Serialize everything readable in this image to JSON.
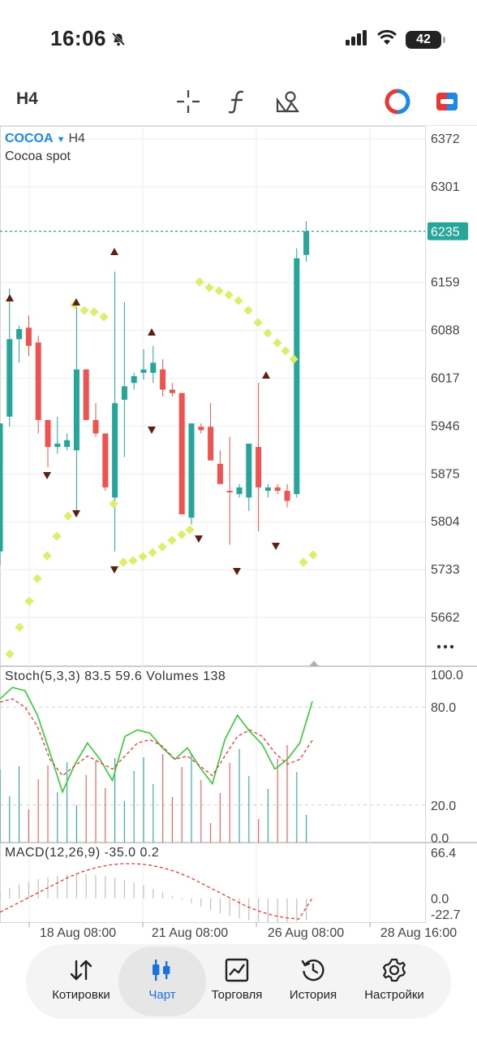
{
  "status_bar": {
    "time": "16:06",
    "battery": "42"
  },
  "toolbar": {
    "timeframe": "H4",
    "icons": [
      "crosshair-icon",
      "function-icon",
      "objects-icon",
      "oneclick-trading-icon",
      "chart-window-icon"
    ]
  },
  "chart": {
    "symbol": "COCOA",
    "timeframe": "H4",
    "description": "Cocoa spot",
    "current_price": "6235",
    "price_ticks": [
      "6372",
      "6301",
      "6159",
      "6088",
      "6017",
      "5946",
      "5875",
      "5804",
      "5733",
      "5662"
    ],
    "time_ticks": [
      "18 Aug 08:00",
      "21 Aug 08:00",
      "26 Aug 08:00",
      "28 Aug 16:00"
    ],
    "colors": {
      "bull": "#26a69a",
      "bear": "#ef5350",
      "psar": "#dbef6b",
      "fractal": "#5d1f10",
      "price_line": "#26a69a"
    }
  },
  "stoch": {
    "label": "Stoch(5,3,3) 83.5 59.6 Volumes 138",
    "ticks": [
      "100.0",
      "80.0",
      "20.0",
      "0.0"
    ]
  },
  "macd": {
    "label": "MACD(12,26,9) -35.0 0.2",
    "ticks": [
      "66.4",
      "0.0",
      "-22.7"
    ]
  },
  "chart_data": {
    "type": "candlestick",
    "title": "COCOA H4",
    "ylim": [
      5620,
      6400
    ],
    "candles": [
      {
        "o": 5760,
        "h": 5950,
        "l": 5740,
        "c": 5950,
        "dir": "up"
      },
      {
        "o": 5960,
        "h": 6150,
        "l": 5945,
        "c": 6075,
        "dir": "up"
      },
      {
        "o": 6075,
        "h": 6095,
        "l": 6040,
        "c": 6090,
        "dir": "up"
      },
      {
        "o": 6092,
        "h": 6110,
        "l": 6050,
        "c": 6065,
        "dir": "down"
      },
      {
        "o": 6070,
        "h": 6080,
        "l": 5935,
        "c": 5955,
        "dir": "down"
      },
      {
        "o": 5955,
        "h": 5955,
        "l": 5885,
        "c": 5915,
        "dir": "down"
      },
      {
        "o": 5915,
        "h": 5960,
        "l": 5905,
        "c": 5920,
        "dir": "up"
      },
      {
        "o": 5915,
        "h": 5935,
        "l": 5910,
        "c": 5925,
        "dir": "up"
      },
      {
        "o": 5910,
        "h": 6130,
        "l": 5820,
        "c": 6030,
        "dir": "up"
      },
      {
        "o": 6030,
        "h": 6030,
        "l": 5955,
        "c": 5955,
        "dir": "down"
      },
      {
        "o": 5955,
        "h": 5980,
        "l": 5930,
        "c": 5935,
        "dir": "down"
      },
      {
        "o": 5935,
        "h": 5935,
        "l": 5850,
        "c": 5855,
        "dir": "down"
      },
      {
        "o": 5840,
        "h": 6175,
        "l": 5760,
        "c": 5980,
        "dir": "up"
      },
      {
        "o": 5985,
        "h": 6130,
        "l": 5900,
        "c": 6005,
        "dir": "up"
      },
      {
        "o": 6010,
        "h": 6025,
        "l": 6000,
        "c": 6020,
        "dir": "up"
      },
      {
        "o": 6025,
        "h": 6060,
        "l": 6015,
        "c": 6030,
        "dir": "up"
      },
      {
        "o": 6040,
        "h": 6065,
        "l": 6010,
        "c": 6025,
        "dir": "up"
      },
      {
        "o": 6030,
        "h": 6045,
        "l": 5990,
        "c": 6000,
        "dir": "down"
      },
      {
        "o": 6000,
        "h": 6010,
        "l": 5990,
        "c": 5995,
        "dir": "down"
      },
      {
        "o": 5995,
        "h": 5995,
        "l": 5815,
        "c": 5815,
        "dir": "down"
      },
      {
        "o": 5810,
        "h": 5950,
        "l": 5800,
        "c": 5950,
        "dir": "up"
      },
      {
        "o": 5945,
        "h": 5950,
        "l": 5935,
        "c": 5940,
        "dir": "down"
      },
      {
        "o": 5945,
        "h": 5980,
        "l": 5905,
        "c": 5895,
        "dir": "down"
      },
      {
        "o": 5890,
        "h": 5910,
        "l": 5860,
        "c": 5860,
        "dir": "down"
      },
      {
        "o": 5850,
        "h": 5930,
        "l": 5770,
        "c": 5850,
        "dir": "down"
      },
      {
        "o": 5845,
        "h": 5860,
        "l": 5840,
        "c": 5855,
        "dir": "up"
      },
      {
        "o": 5840,
        "h": 5920,
        "l": 5820,
        "c": 5920,
        "dir": "up"
      },
      {
        "o": 5915,
        "h": 6010,
        "l": 5790,
        "c": 5855,
        "dir": "down"
      },
      {
        "o": 5850,
        "h": 5860,
        "l": 5840,
        "c": 5855,
        "dir": "up"
      },
      {
        "o": 5850,
        "h": 5860,
        "l": 5845,
        "c": 5855,
        "dir": "down"
      },
      {
        "o": 5850,
        "h": 5860,
        "l": 5825,
        "c": 5835,
        "dir": "down"
      },
      {
        "o": 5845,
        "h": 6210,
        "l": 5840,
        "c": 6195,
        "dir": "up"
      },
      {
        "o": 6200,
        "h": 6250,
        "l": 6190,
        "c": 6235,
        "dir": "up"
      }
    ],
    "stoch_main": [
      85,
      92,
      90,
      75,
      52,
      28,
      45,
      58,
      48,
      35,
      62,
      66,
      64,
      55,
      48,
      55,
      43,
      33,
      60,
      75,
      65,
      57,
      42,
      48,
      58,
      83.5
    ],
    "stoch_signal": [
      83,
      85,
      80,
      68,
      48,
      38,
      44,
      50,
      46,
      42,
      50,
      58,
      60,
      56,
      48,
      50,
      44,
      38,
      50,
      62,
      66,
      62,
      52,
      45,
      48,
      59.6
    ],
    "macd_signal": [
      -20,
      -10,
      0,
      10,
      20,
      30,
      38,
      44,
      48,
      50,
      50,
      48,
      44,
      38,
      30,
      20,
      10,
      0,
      -10,
      -18,
      -24,
      -28,
      -30,
      0.2
    ]
  }
}
